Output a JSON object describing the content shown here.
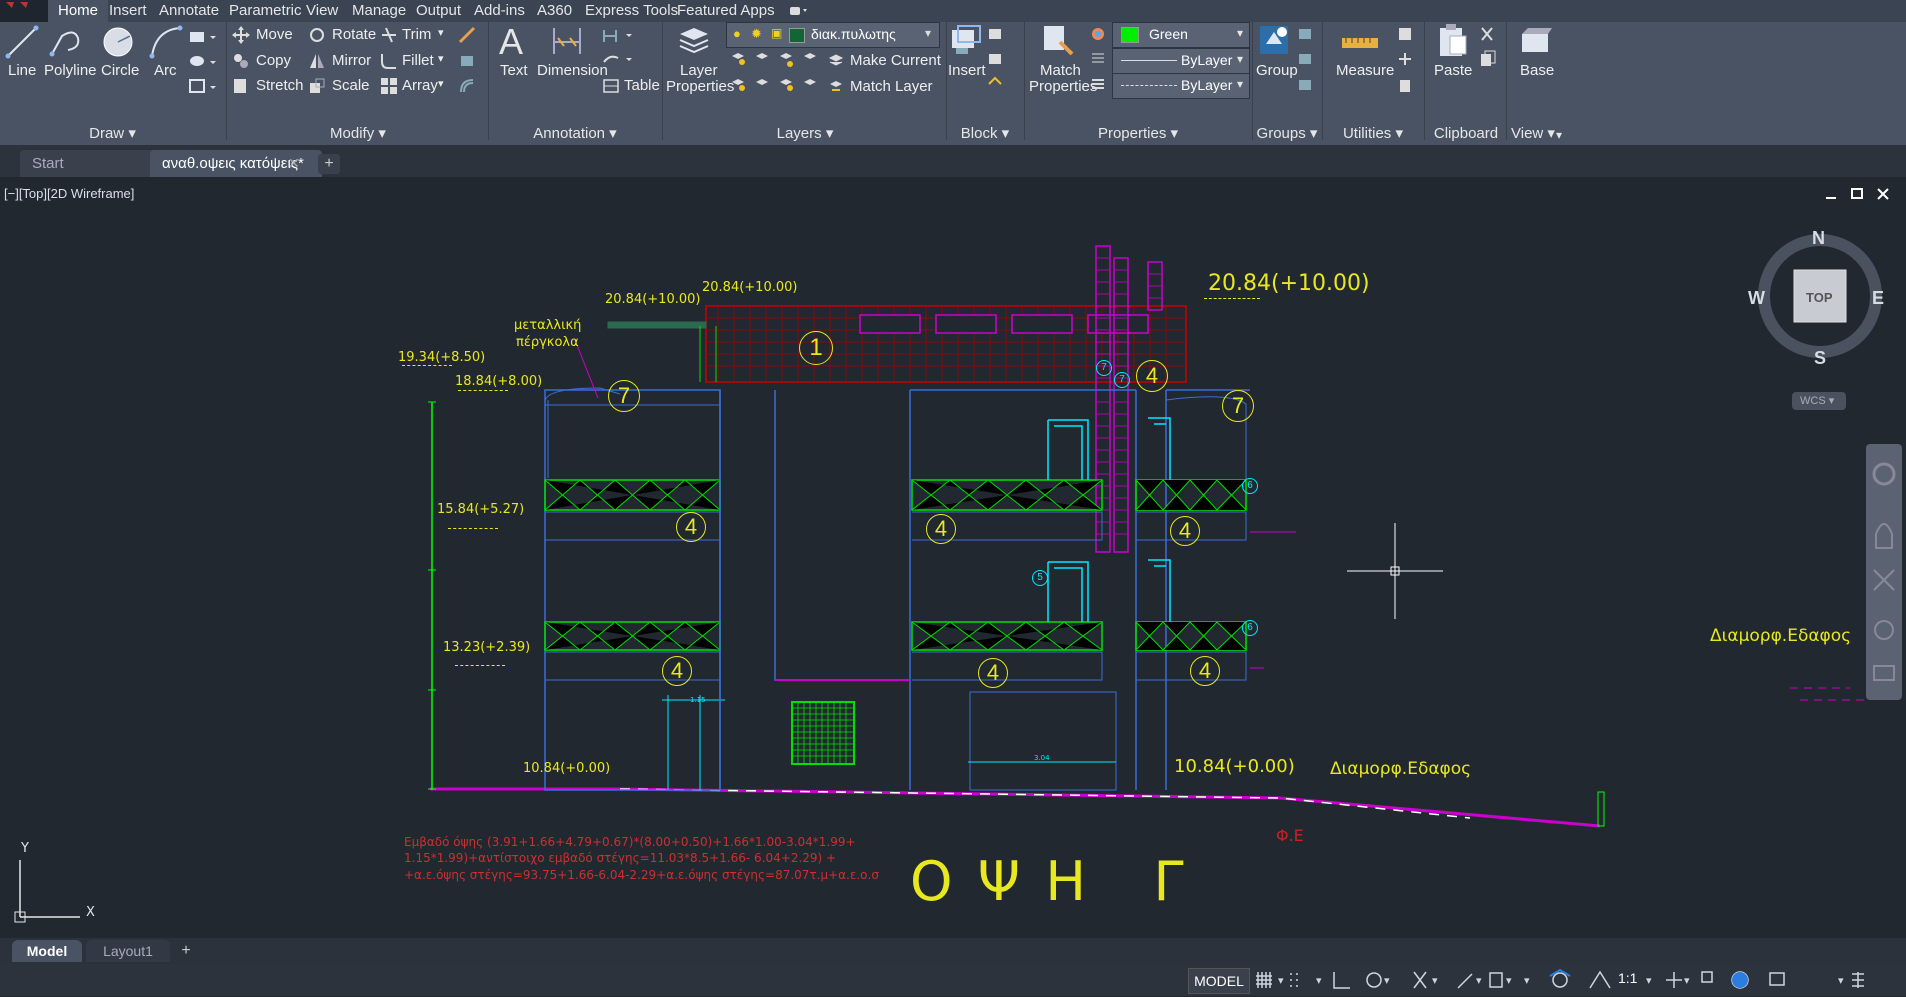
{
  "menu": {
    "tabs": [
      "Home",
      "Insert",
      "Annotate",
      "Parametric",
      "View",
      "Manage",
      "Output",
      "Add-ins",
      "A360",
      "Express Tools",
      "Featured Apps"
    ]
  },
  "ribbon": {
    "draw": {
      "title": "Draw",
      "line": "Line",
      "polyline": "Polyline",
      "circle": "Circle",
      "arc": "Arc"
    },
    "modify": {
      "title": "Modify",
      "move": "Move",
      "rotate": "Rotate",
      "trim": "Trim",
      "copy": "Copy",
      "mirror": "Mirror",
      "fillet": "Fillet",
      "stretch": "Stretch",
      "scale": "Scale",
      "array": "Array"
    },
    "annotation": {
      "title": "Annotation",
      "text": "Text",
      "dimension": "Dimension",
      "table": "Table"
    },
    "layers": {
      "title": "Layers",
      "layer_properties_1": "Layer",
      "layer_properties_2": "Properties",
      "current_layer": "διακ.πυλωτης",
      "make_current": "Make Current",
      "match_layer": "Match Layer"
    },
    "block": {
      "title": "Block",
      "insert": "Insert"
    },
    "properties": {
      "title": "Properties",
      "match_1": "Match",
      "match_2": "Properties",
      "color": "Green",
      "linetype": "ByLayer",
      "lineweight": "ByLayer"
    },
    "groups": {
      "title": "Groups",
      "group": "Group"
    },
    "utilities": {
      "title": "Utilities",
      "measure": "Measure"
    },
    "clipboard": {
      "title": "Clipboard",
      "paste": "Paste"
    },
    "view": {
      "title": "View",
      "base": "Base"
    }
  },
  "filetabs": {
    "start": "Start",
    "current": "αναθ.οψεις κατόψεις*"
  },
  "viewport": {
    "label": "[−][Top][2D Wireframe]"
  },
  "viewcube": {
    "n": "N",
    "s": "S",
    "e": "E",
    "w": "W",
    "top": "TOP",
    "wcs": "WCS"
  },
  "drawing": {
    "levels": {
      "top_right": "20.84(+10.00)",
      "top_a": "20.84(+10.00)",
      "top_b": "20.84(+10.00)",
      "l1934": "19.34(+8.50)",
      "l1884": "18.84(+8.00)",
      "l1584": "15.84(+5.27)",
      "l1323": "13.23(+2.39)",
      "l1084_left": "10.84(+0.00)",
      "l1084_right": "10.84(+0.00)"
    },
    "pergola_1": "μεταλλική",
    "pergola_2": "πέργκολα",
    "ground_label": "Διαμορφ.Εδαφος",
    "ground_label_right": "Διαμορφ.Εδαφος",
    "fe_label": "Φ.Ε",
    "area_1": "Εμβαδό όψης (3.91+1.66+4.79+0.67)*(8.00+0.50)+1.66*1.00-3.04*1.99+",
    "area_2": "1.15*1.99)+αντίστοιχο εμβαδό στέγης=11.03*8.5+1.66- 6.04+2.29) +",
    "area_3": "+α.ε.όψης στέγης=93.75+1.66-6.04-2.29+α.ε.όψης στέγης=87.07τ.μ+α.ε.ο.σ",
    "title": "Ο Ψ Η   Γ",
    "tags": {
      "t1": "1",
      "t4": "4",
      "t5": "5",
      "t6": "6",
      "t7": "7"
    }
  },
  "layout_tabs": {
    "model": "Model",
    "layout1": "Layout1"
  },
  "status": {
    "model": "MODEL",
    "scale": "1:1"
  }
}
